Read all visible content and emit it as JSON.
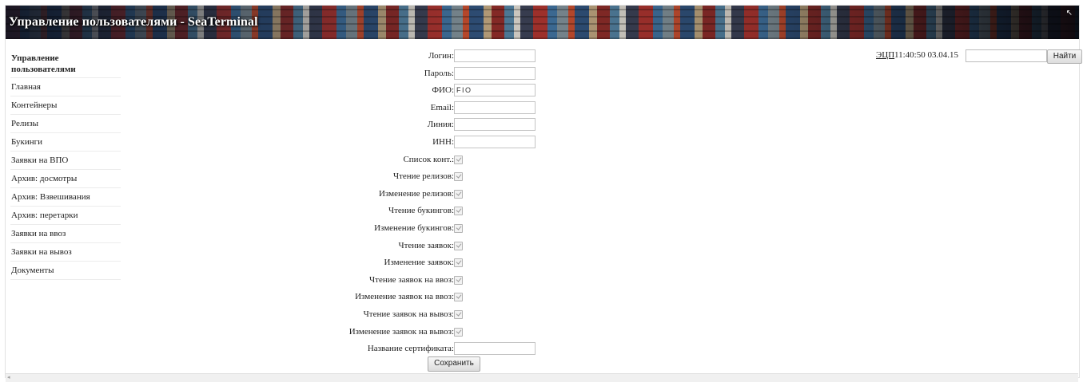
{
  "banner": {
    "title": "Управление пользователями - SeaTerminal"
  },
  "sidebar": {
    "items": [
      {
        "label": "Управление пользователями"
      },
      {
        "label": "Главная"
      },
      {
        "label": "Контейнеры"
      },
      {
        "label": "Релизы"
      },
      {
        "label": "Букинги"
      },
      {
        "label": "Заявки на ВПО"
      },
      {
        "label": "Архив: досмотры"
      },
      {
        "label": "Архив: Взвешивания"
      },
      {
        "label": "Архив: перетарки"
      },
      {
        "label": "Заявки на ввоз"
      },
      {
        "label": "Заявки на вывоз"
      },
      {
        "label": "Документы"
      }
    ]
  },
  "header": {
    "ecp_link": "ЭЦП",
    "datetime": "11:40:50 03.04.15",
    "search_value": "",
    "find_label": "Найти"
  },
  "form": {
    "login_label": "Логин:",
    "login_value": "",
    "password_label": "Пароль:",
    "password_value": "",
    "fio_label": "ФИО:",
    "fio_value": "FIO",
    "email_label": "Email:",
    "email_value": "",
    "line_label": "Линия:",
    "line_value": "",
    "inn_label": "ИНН:",
    "inn_value": "",
    "checkboxes": [
      {
        "label": "Список конт.:",
        "checked": true
      },
      {
        "label": "Чтение релизов:",
        "checked": true
      },
      {
        "label": "Изменение релизов:",
        "checked": true
      },
      {
        "label": "Чтение букингов:",
        "checked": true
      },
      {
        "label": "Изменение букингов:",
        "checked": true
      },
      {
        "label": "Чтение заявок:",
        "checked": true
      },
      {
        "label": "Изменение заявок:",
        "checked": true
      },
      {
        "label": "Чтение заявок на ввоз:",
        "checked": true
      },
      {
        "label": "Изменение заявок на ввоз:",
        "checked": true
      },
      {
        "label": "Чтение заявок на вывоз:",
        "checked": true
      },
      {
        "label": "Изменение заявок на вывоз:",
        "checked": true
      }
    ],
    "cert_label": "Название сертификата:",
    "cert_value": "",
    "save_label": "Сохранить"
  }
}
